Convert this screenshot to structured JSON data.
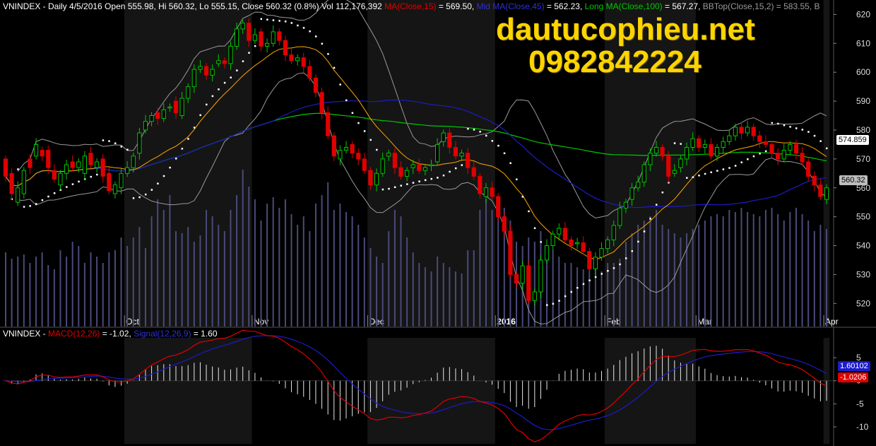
{
  "header": {
    "symbol": "VNINDEX",
    "info": " - Daily 4/5/2016 Open 555.98, Hi 560.32, Lo 555.15, Close 560.32 (0.8%) Vol 112,176,392 ",
    "ma15_label": "MA(Close,15)",
    "ma15_value": " = 569.50, ",
    "ma45_label": "Mid MA(Close,45)",
    "ma45_value": " = 562.23, ",
    "ma100_label": "Long MA(Close,100)",
    "ma100_value": " = 567.27, ",
    "bb_label": "BBTop(Close,15,2) = 583.55, B"
  },
  "macd_header": {
    "symbol": "VNINDEX",
    "sep": " - ",
    "macd_label": "MACD(12,26)",
    "macd_value": " = -1.02, ",
    "signal_label": "Signal(12,26,9)",
    "signal_value": " = 1.60"
  },
  "watermark": {
    "site": "dautucophieu.net",
    "phone": "0982842224"
  },
  "tags": {
    "price_last": "560.32",
    "price_marker": "574.859",
    "signal_tag": "1.60102",
    "macd_tag": "-1.0206"
  },
  "colors": {
    "bull": "#00c800",
    "bear": "#e00000",
    "ma15": "#ffa500",
    "ma45": "#1c1cc8",
    "ma100": "#00c800",
    "bb": "#9a9a9a",
    "volume": "#4a4a7a",
    "macd": "#e00000",
    "signal": "#1c1cc8"
  },
  "chart_data": [
    {
      "type": "candlestick",
      "name": "VNINDEX",
      "yrange": [
        512,
        625
      ],
      "y_ticks": [
        520,
        530,
        540,
        550,
        560,
        570,
        580,
        590,
        600,
        610,
        620
      ],
      "x_labels": [
        "Oct",
        "Nov",
        "Dec",
        "2016",
        "Feb",
        "Mar",
        "Apr"
      ],
      "x_label_index": [
        20,
        41,
        60,
        81,
        99,
        114,
        135
      ],
      "close": [
        564,
        558,
        560,
        566,
        567,
        575,
        571,
        567,
        563,
        565,
        568,
        567,
        569,
        571,
        568,
        569,
        564,
        559,
        561,
        565,
        567,
        571,
        579,
        583,
        585,
        584,
        587,
        588,
        586,
        591,
        595,
        601,
        602,
        599,
        601,
        604,
        603,
        609,
        615,
        617,
        611,
        613,
        609,
        610,
        614,
        611,
        606,
        604,
        605,
        602,
        598,
        593,
        586,
        578,
        571,
        573,
        574,
        572,
        570,
        566,
        561,
        565,
        570,
        572,
        567,
        564,
        566,
        568,
        566,
        567,
        568,
        575,
        579,
        574,
        571,
        572,
        567,
        564,
        558,
        560,
        557,
        550,
        545,
        530,
        527,
        533,
        521,
        524,
        535,
        540,
        544,
        546,
        542,
        540,
        541,
        538,
        532,
        536,
        539,
        542,
        547,
        553,
        555,
        560,
        562,
        568,
        572,
        574,
        571,
        564,
        566,
        570,
        574,
        577,
        574,
        575,
        571,
        574,
        576,
        578,
        581,
        579,
        581,
        578,
        576,
        575,
        572,
        570,
        573,
        575,
        572,
        569,
        564,
        561,
        557,
        560
      ],
      "open": [
        570,
        565,
        555,
        558,
        570,
        571,
        573,
        573,
        566,
        561,
        565,
        569,
        567,
        565,
        572,
        567,
        570,
        565,
        558,
        560,
        565,
        567,
        572,
        580,
        583,
        586,
        584,
        588,
        590,
        585,
        591,
        595,
        601,
        602,
        599,
        603,
        604,
        603,
        609,
        615,
        617,
        611,
        614,
        609,
        610,
        614,
        611,
        606,
        604,
        605,
        602,
        598,
        593,
        586,
        578,
        570,
        573,
        575,
        572,
        570,
        566,
        561,
        565,
        571,
        572,
        567,
        564,
        567,
        568,
        566,
        568,
        569,
        576,
        579,
        574,
        571,
        572,
        567,
        564,
        557,
        560,
        557,
        550,
        545,
        530,
        527,
        533,
        521,
        524,
        535,
        540,
        544,
        546,
        542,
        541,
        541,
        538,
        532,
        536,
        539,
        542,
        547,
        553,
        556,
        560,
        562,
        568,
        572,
        574,
        571,
        565,
        567,
        570,
        574,
        577,
        574,
        575,
        571,
        574,
        576,
        578,
        581,
        579,
        581,
        578,
        576,
        575,
        572,
        570,
        573,
        575,
        572,
        569,
        564,
        561,
        556
      ],
      "volume": [
        0.35,
        0.32,
        0.33,
        0.34,
        0.3,
        0.33,
        0.35,
        0.29,
        0.27,
        0.36,
        0.33,
        0.4,
        0.38,
        0.3,
        0.35,
        0.33,
        0.3,
        0.35,
        0.36,
        0.42,
        0.38,
        0.42,
        0.47,
        0.37,
        0.52,
        0.6,
        0.55,
        0.62,
        0.45,
        0.44,
        0.47,
        0.4,
        0.43,
        0.55,
        0.52,
        0.48,
        0.45,
        0.55,
        0.62,
        0.74,
        0.66,
        0.6,
        0.5,
        0.58,
        0.61,
        0.56,
        0.6,
        0.53,
        0.48,
        0.52,
        0.45,
        0.58,
        0.62,
        0.68,
        0.55,
        0.58,
        0.54,
        0.52,
        0.48,
        0.42,
        0.37,
        0.33,
        0.3,
        0.45,
        0.55,
        0.52,
        0.42,
        0.35,
        0.3,
        0.28,
        0.26,
        0.33,
        0.3,
        0.28,
        0.26,
        0.25,
        0.36,
        0.36,
        0.55,
        0.6,
        0.55,
        0.55,
        0.56,
        0.5,
        0.4,
        0.38,
        0.42,
        0.4,
        0.45,
        0.38,
        0.36,
        0.33,
        0.3,
        0.3,
        0.28,
        0.27,
        0.28,
        0.3,
        0.26,
        0.3,
        0.3,
        0.32,
        0.4,
        0.44,
        0.48,
        0.5,
        0.52,
        0.55,
        0.48,
        0.46,
        0.44,
        0.42,
        0.44,
        0.46,
        0.48,
        0.5,
        0.52,
        0.53,
        0.52,
        0.55,
        0.54,
        0.56,
        0.54,
        0.53,
        0.52,
        0.55,
        0.56,
        0.53,
        0.5,
        0.54,
        0.56,
        0.53,
        0.5,
        0.45,
        0.48,
        0.46
      ]
    },
    {
      "type": "line",
      "name": "MACD",
      "yrange": [
        -12,
        9
      ],
      "y_ticks": [
        -10,
        -5,
        0,
        5
      ],
      "series": [
        {
          "name": "MACD(12,26)"
        },
        {
          "name": "Signal(12,26,9)"
        }
      ]
    }
  ]
}
